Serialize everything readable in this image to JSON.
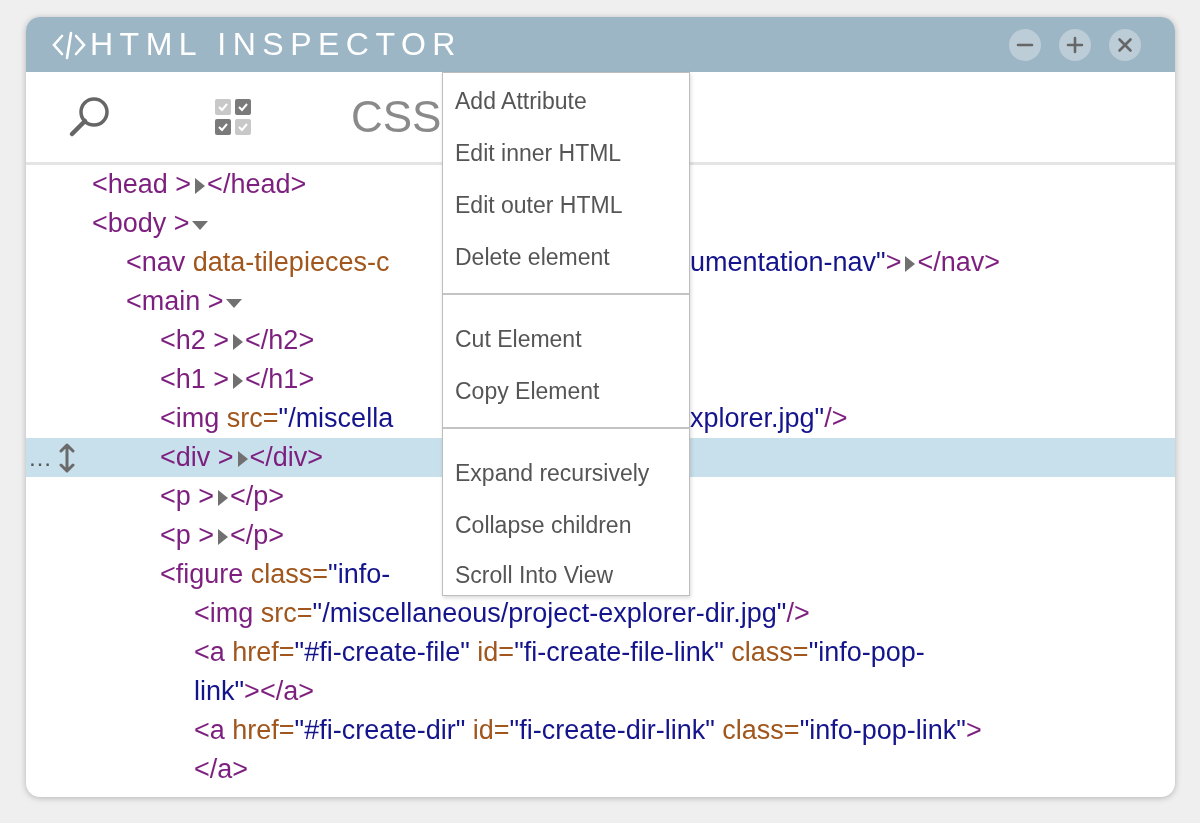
{
  "window": {
    "title": "HTML INSPECTOR"
  },
  "toolbar": {
    "label": "CSS"
  },
  "tree": {
    "nodes": [
      {
        "selected": false,
        "expanded": false,
        "lines": [
          [
            {
              "kind": "tag",
              "text": "<head >"
            },
            {
              "kind": "toggle"
            },
            {
              "kind": "tag",
              "text": "</head>"
            }
          ]
        ]
      },
      {
        "selected": false,
        "expanded": true,
        "lines": [
          [
            {
              "kind": "tag",
              "text": "<body >"
            },
            {
              "kind": "toggle"
            }
          ]
        ],
        "children": [
          {
            "selected": false,
            "expanded": false,
            "lines": [
              [
                {
                  "kind": "tag",
                  "text": "<nav "
                },
                {
                  "kind": "attr",
                  "text": "data-tilepieces-c"
                },
                {
                  "kind": "hidden"
                },
                {
                  "kind": "value",
                  "text": "umentation-nav\""
                },
                {
                  "kind": "tag",
                  "text": ">"
                },
                {
                  "kind": "toggle"
                },
                {
                  "kind": "tag",
                  "text": "</nav>"
                }
              ]
            ]
          },
          {
            "selected": false,
            "expanded": true,
            "lines": [
              [
                {
                  "kind": "tag",
                  "text": "<main >"
                },
                {
                  "kind": "toggle"
                }
              ]
            ],
            "children": [
              {
                "selected": false,
                "expanded": false,
                "lines": [
                  [
                    {
                      "kind": "tag",
                      "text": "<h2 >"
                    },
                    {
                      "kind": "toggle"
                    },
                    {
                      "kind": "tag",
                      "text": "</h2>"
                    }
                  ]
                ]
              },
              {
                "selected": false,
                "expanded": false,
                "lines": [
                  [
                    {
                      "kind": "tag",
                      "text": "<h1 >"
                    },
                    {
                      "kind": "toggle"
                    },
                    {
                      "kind": "tag",
                      "text": "</h1>"
                    }
                  ]
                ]
              },
              {
                "selected": false,
                "lines": [
                  [
                    {
                      "kind": "tag",
                      "text": "<img "
                    },
                    {
                      "kind": "attr",
                      "text": "src="
                    },
                    {
                      "kind": "value",
                      "text": "\"/miscella"
                    },
                    {
                      "kind": "hidden"
                    },
                    {
                      "kind": "value",
                      "text": "xplorer.jpg\""
                    },
                    {
                      "kind": "tag",
                      "text": "/>"
                    }
                  ]
                ]
              },
              {
                "selected": true,
                "expanded": false,
                "handle": "…",
                "lines": [
                  [
                    {
                      "kind": "tag",
                      "text": "<div >"
                    },
                    {
                      "kind": "toggle"
                    },
                    {
                      "kind": "tag",
                      "text": "</div>"
                    }
                  ]
                ]
              },
              {
                "selected": false,
                "expanded": false,
                "lines": [
                  [
                    {
                      "kind": "tag",
                      "text": "<p >"
                    },
                    {
                      "kind": "toggle"
                    },
                    {
                      "kind": "tag",
                      "text": "</p>"
                    }
                  ]
                ]
              },
              {
                "selected": false,
                "expanded": false,
                "lines": [
                  [
                    {
                      "kind": "tag",
                      "text": "<p >"
                    },
                    {
                      "kind": "toggle"
                    },
                    {
                      "kind": "tag",
                      "text": "</p>"
                    }
                  ]
                ]
              },
              {
                "selected": false,
                "lines": [
                  [
                    {
                      "kind": "tag",
                      "text": "<figure "
                    },
                    {
                      "kind": "attr",
                      "text": "class="
                    },
                    {
                      "kind": "value",
                      "text": "\"info-"
                    },
                    {
                      "kind": "hidden"
                    }
                  ]
                ],
                "children": [
                  {
                    "selected": false,
                    "lines": [
                      [
                        {
                          "kind": "tag",
                          "text": "<img "
                        },
                        {
                          "kind": "attr",
                          "text": "src="
                        },
                        {
                          "kind": "value",
                          "text": "\"/miscellaneous/project-explorer-dir.jpg\""
                        },
                        {
                          "kind": "tag",
                          "text": "/>"
                        }
                      ]
                    ]
                  },
                  {
                    "selected": false,
                    "lines": [
                      [
                        {
                          "kind": "tag",
                          "text": "<a "
                        },
                        {
                          "kind": "attr",
                          "text": "href="
                        },
                        {
                          "kind": "value",
                          "text": "\"#fi-create-file\" "
                        },
                        {
                          "kind": "attr",
                          "text": "id="
                        },
                        {
                          "kind": "value",
                          "text": "\"fi-create-file-link\" "
                        },
                        {
                          "kind": "attr",
                          "text": "class="
                        },
                        {
                          "kind": "value",
                          "text": "\"info-pop-"
                        }
                      ],
                      [
                        {
                          "kind": "value",
                          "text": "link\""
                        },
                        {
                          "kind": "tag",
                          "text": "></a>"
                        }
                      ]
                    ]
                  },
                  {
                    "selected": false,
                    "lines": [
                      [
                        {
                          "kind": "tag",
                          "text": "<a "
                        },
                        {
                          "kind": "attr",
                          "text": "href="
                        },
                        {
                          "kind": "value",
                          "text": "\"#fi-create-dir\" "
                        },
                        {
                          "kind": "attr",
                          "text": "id="
                        },
                        {
                          "kind": "value",
                          "text": "\"fi-create-dir-link\" "
                        },
                        {
                          "kind": "attr",
                          "text": "class="
                        },
                        {
                          "kind": "value",
                          "text": "\"info-pop-link\""
                        },
                        {
                          "kind": "tag",
                          "text": ">"
                        }
                      ],
                      [
                        {
                          "kind": "tag",
                          "text": "</a>"
                        }
                      ]
                    ]
                  }
                ]
              }
            ]
          }
        ]
      }
    ]
  },
  "context_menu": {
    "groups": [
      [
        "Add Attribute",
        "Edit inner HTML",
        "Edit outer HTML",
        "Delete element"
      ],
      [
        "Cut Element",
        "Copy Element"
      ],
      [
        "Expand recursively",
        "Collapse children",
        "Scroll Into View"
      ]
    ]
  }
}
